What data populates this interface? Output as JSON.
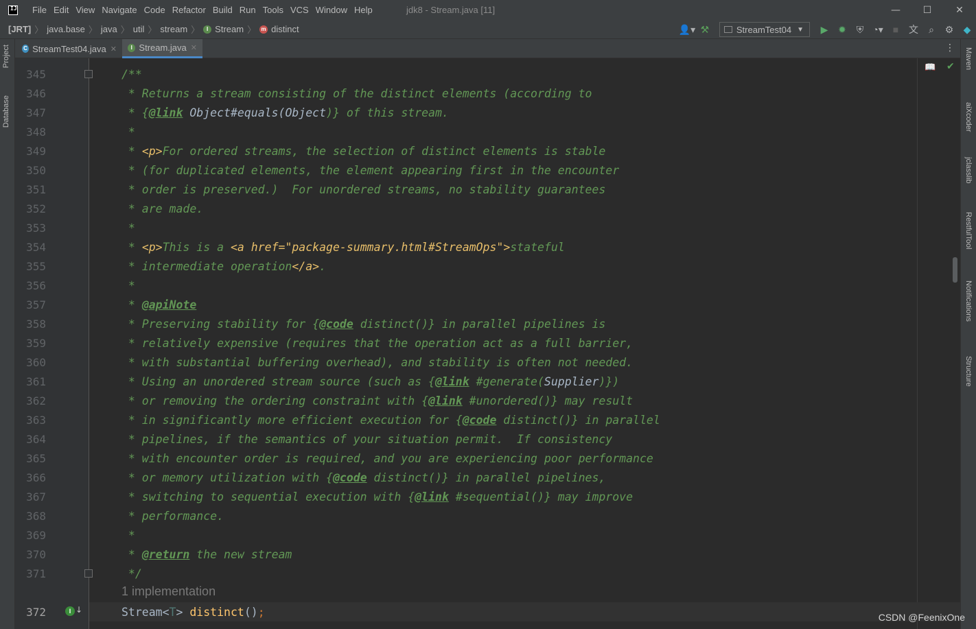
{
  "title_bar": {
    "logo_text": "IJ",
    "menu": [
      "File",
      "Edit",
      "View",
      "Navigate",
      "Code",
      "Refactor",
      "Build",
      "Run",
      "Tools",
      "VCS",
      "Window",
      "Help"
    ],
    "window_title": "jdk8 - Stream.java [11]",
    "controls": {
      "minimize": "—",
      "maximize": "☐",
      "close": "✕"
    }
  },
  "breadcrumb": {
    "items": [
      "[JRT]",
      "java.base",
      "java",
      "util",
      "stream",
      "Stream",
      "distinct"
    ]
  },
  "toolbar": {
    "run_config": "StreamTest04"
  },
  "left_tools": [
    "Project",
    "Database"
  ],
  "right_tools": [
    "Maven",
    "aiXcoder",
    "jclasslib",
    "RestfulTool",
    "Notifications",
    "Structure"
  ],
  "tabs": [
    {
      "label": "StreamTest04.java",
      "active": false
    },
    {
      "label": "Stream.java",
      "active": true
    }
  ],
  "editor": {
    "implementation_hint": "1 implementation",
    "lines": {
      "l345": "345",
      "l346": "346",
      "l347": "347",
      "l348": "348",
      "l349": "349",
      "l350": "350",
      "l351": "351",
      "l352": "352",
      "l353": "353",
      "l354": "354",
      "l355": "355",
      "l356": "356",
      "l357": "357",
      "l358": "358",
      "l359": "359",
      "l360": "360",
      "l361": "361",
      "l362": "362",
      "l363": "363",
      "l364": "364",
      "l365": "365",
      "l366": "366",
      "l367": "367",
      "l368": "368",
      "l369": "369",
      "l370": "370",
      "l371": "371",
      "l372": "372"
    },
    "code": {
      "c345": "/**",
      "c346": " * Returns a stream consisting of the distinct elements (according to",
      "c347a": " * {",
      "c347tag": "@link",
      "c347ref": " Object#equals(",
      "c347ref2": "Object",
      "c347b": ")} of this stream.",
      "c348": " *",
      "c349a": " * ",
      "c349html": "<p>",
      "c349b": "For ordered streams, the selection of distinct elements is stable",
      "c350": " * (for duplicated elements, the element appearing first in the encounter",
      "c351": " * order is preserved.)  For unordered streams, no stability guarantees",
      "c352": " * are made.",
      "c353": " *",
      "c354a": " * ",
      "c354html1": "<p>",
      "c354b": "This is a ",
      "c354html2": "<a href=\"package-summary.html#StreamOps\">",
      "c354c": "stateful",
      "c355a": " * intermediate operation",
      "c355html": "</a>",
      "c355b": ".",
      "c356": " *",
      "c357a": " * ",
      "c357tag": "@apiNote",
      "c358a": " * Preserving stability for {",
      "c358tag": "@code",
      "c358b": " distinct()} in parallel pipelines is",
      "c359": " * relatively expensive (requires that the operation act as a full barrier,",
      "c360": " * with substantial buffering overhead), and stability is often not needed.",
      "c361a": " * Using an unordered stream source (such as {",
      "c361tag": "@link",
      "c361b": " #generate(",
      "c361ref": "Supplier",
      "c361c": ")})",
      "c362a": " * or removing the ordering constraint with {",
      "c362tag": "@link",
      "c362b": " #unordered()} may result",
      "c363a": " * in significantly more efficient execution for {",
      "c363tag": "@code",
      "c363b": " distinct()} in parallel",
      "c364": " * pipelines, if the semantics of your situation permit.  If consistency",
      "c365": " * with encounter order is required, and you are experiencing poor performance",
      "c366a": " * or memory utilization with {",
      "c366tag": "@code",
      "c366b": " distinct()} in parallel pipelines,",
      "c367a": " * switching to sequential execution with {",
      "c367tag": "@link",
      "c367b": " #sequential()} may improve",
      "c368": " * performance.",
      "c369": " *",
      "c370a": " * ",
      "c370tag": "@return",
      "c370b": " the new stream",
      "c371": " */",
      "c372type": "Stream<",
      "c372T": "T",
      "c372gt": "> ",
      "c372meth": "distinct",
      "c372paren": "()",
      "c372semi": ";"
    }
  },
  "watermark": "CSDN @FeenixOne"
}
